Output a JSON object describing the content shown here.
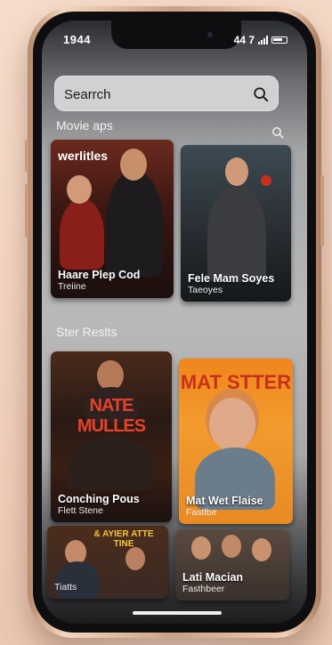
{
  "status_bar": {
    "time": "1944",
    "carrier": "44 7"
  },
  "search": {
    "placeholder": "Searrch"
  },
  "sections": {
    "movies_title": "Movie aps",
    "results_title": "Ster Reslts"
  },
  "movies": [
    {
      "poster_text": "werlitles",
      "title": "Haare Plep Cod",
      "subtitle": "Treiine"
    },
    {
      "poster_text": "",
      "title": "Fele Mam Soyes",
      "subtitle": "Taeoyes"
    }
  ],
  "results": [
    {
      "poster_text": "NATE MULLES",
      "title": "Conching Pous",
      "subtitle": "Flett Stene"
    },
    {
      "poster_text": "MAT STTER",
      "title": "Mat Wet Flaise",
      "subtitle": "Fastlbe"
    },
    {
      "poster_text": "& AYIER ATTE TINE",
      "title": "",
      "subtitle": "Tiatts"
    },
    {
      "poster_text": "",
      "title": "Lati Macian",
      "subtitle": "Fasthbeer"
    }
  ],
  "colors": {
    "accent_orange": "#f08a1c",
    "poster_red": "#c9301b",
    "screen_bg": "#b9b9b9"
  }
}
